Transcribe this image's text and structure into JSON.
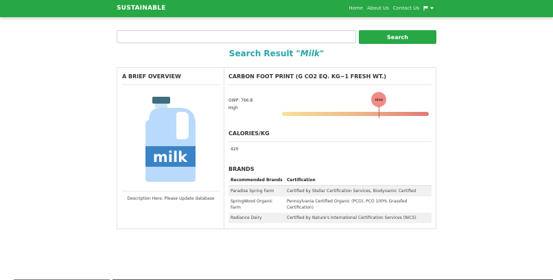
{
  "navbar": {
    "brand": "SUSTAINABLE",
    "links": [
      "Home",
      "About Us",
      "Contact Us"
    ],
    "flag_icon": "flag-icon"
  },
  "search": {
    "value": "",
    "placeholder": "",
    "button_label": "Search"
  },
  "result": {
    "prefix": "Search Result \"",
    "query": "Milk",
    "suffix": "\""
  },
  "overview": {
    "heading": "A BRIEF OVERVIEW",
    "image_label": "milk",
    "description": "Description Here. Please Update database"
  },
  "carbon": {
    "heading": "CARBON FOOT PRINT (G CO2 EQ. KG−1 FRESH WT.)",
    "gwp": "GWP: 766.8",
    "level": "High",
    "marker_label": "HIGH",
    "marker_fraction": 0.66
  },
  "calories": {
    "heading": "CALORIES/KG",
    "value": "420"
  },
  "brands": {
    "heading": "BRANDS",
    "columns": [
      "Recommended Brands",
      "Certification"
    ],
    "rows": [
      {
        "brand": "Paradise Spring Farm",
        "certification": "Certified by Stellar Certification Services, Biodynamic Certified"
      },
      {
        "brand": "SpringWood Organic Farm",
        "certification": "Pennsylvania Certified Organic (PCO), PCO 100% Grassfed Certification)"
      },
      {
        "brand": "Radiance Dairy",
        "certification": "Certified by Nature's International Certification Services (NICS)"
      }
    ]
  },
  "colors": {
    "primary": "#28a745",
    "title": "#2aa6a9"
  }
}
